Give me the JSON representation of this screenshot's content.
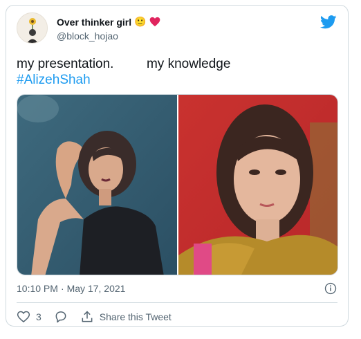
{
  "user": {
    "display_name": "Over thinker girl",
    "name_emojis": "🙂",
    "handle": "@block_hojao"
  },
  "tweet": {
    "text_part1": "my presentation.",
    "text_gap": "         ",
    "text_part2": "my knowledge",
    "hashtag": "#AlizehShah"
  },
  "media": {
    "left_image": "woman posing in black top against teal background",
    "right_image": "woman with mustard shawl against red background"
  },
  "meta": {
    "time": "10:10 PM",
    "separator": "·",
    "date": "May 17, 2021"
  },
  "actions": {
    "like_count": "3",
    "share_label": "Share this Tweet"
  },
  "colors": {
    "accent": "#1d9bf0",
    "heart": "#f91880",
    "text_secondary": "#536471",
    "border": "#cfd9de"
  }
}
